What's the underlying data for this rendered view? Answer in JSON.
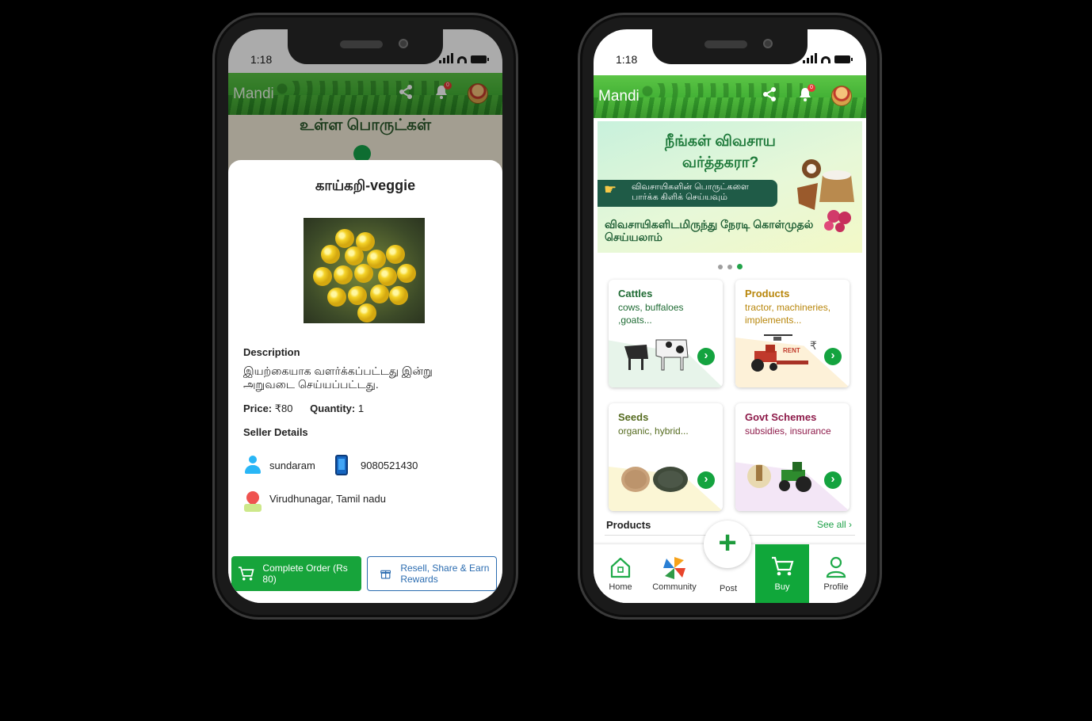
{
  "status": {
    "time": "1:18"
  },
  "left": {
    "app_title": "Mandi",
    "notification_count": "0",
    "behind_text": "உள்ள பொருட்கள்",
    "product": {
      "title": "காய்கறி-veggie",
      "description_label": "Description",
      "description": "இயற்கையாக வளர்க்கப்பட்டது இன்று அறுவடை செய்யப்பட்டது.",
      "price_label": "Price:",
      "price_value": "₹80",
      "quantity_label": "Quantity:",
      "quantity_value": "1"
    },
    "seller": {
      "heading": "Seller Details",
      "name": "sundaram",
      "phone": "9080521430",
      "location": "Virudhunagar, Tamil nadu"
    },
    "buttons": {
      "complete": "Complete Order (Rs 80)",
      "resell": "Resell, Share & Earn Rewards"
    }
  },
  "right": {
    "app_title": "Mandi",
    "notification_count": "0",
    "banner": {
      "headline": "நீங்கள் விவசாய வர்த்தகரா?",
      "pill": "விவசாயிகளின் பொருட்களை பார்க்க கிளிக் செய்யவும்",
      "subline": "விவசாயிகளிடமிருந்து நேரடி கொள்முதல் செய்யலாம்"
    },
    "carousel": {
      "count": 3,
      "active": 3
    },
    "categories": [
      {
        "title": "Cattles",
        "subtitle": "cows, buffaloes ,goats...",
        "title_color": "#1f6b34",
        "sub_color": "#1f6b34",
        "blob": "#e7f4ea"
      },
      {
        "title": "Products",
        "subtitle": "tractor, machineries, implements...",
        "title_color": "#b8860b",
        "sub_color": "#b8860b",
        "blob": "#fdf1d8"
      },
      {
        "title": "Seeds",
        "subtitle": "organic, hybrid...",
        "title_color": "#556b1f",
        "sub_color": "#556b1f",
        "blob": "#fbf6d5"
      },
      {
        "title": "Govt Schemes",
        "subtitle": "subsidies, insurance",
        "title_color": "#8e1b4a",
        "sub_color": "#8e1b4a",
        "blob": "#f3e6f6"
      }
    ],
    "products_section": {
      "heading": "Products",
      "see_all": "See all ›"
    },
    "tabs": {
      "home": "Home",
      "community": "Community",
      "post": "Post",
      "buy": "Buy",
      "profile": "Profile"
    }
  },
  "colors": {
    "brand_green": "#17a43b",
    "link_blue": "#2b6cb0"
  }
}
